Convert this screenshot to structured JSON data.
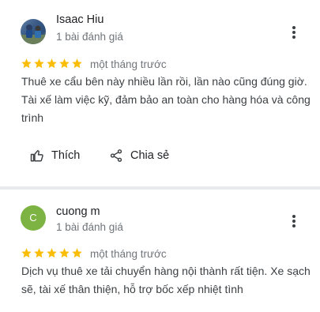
{
  "reviews": [
    {
      "name": "Isaac Hiu",
      "review_count": "1 bài đánh giá",
      "rating": 5,
      "date": "một tháng trước",
      "text": "Thuê xe cẩu bên này nhiều lần rồi, lần nào cũng đúng giờ. Tài xế làm việc kỹ, đảm bảo an toàn cho hàng hóa và công trình",
      "like_label": "Thích",
      "share_label": "Chia sẻ"
    },
    {
      "name": "cuong m",
      "avatar_letter": "C",
      "review_count": "1 bài đánh giá",
      "rating": 5,
      "date": "một tháng trước",
      "text": "Dịch vụ thuê xe tải chuyển hàng nội thành rất tiện. Xe sạch sẽ, tài xế thân thiện, hỗ trợ bốc xếp nhiệt tình"
    }
  ],
  "colors": {
    "star": "#fbbc04",
    "avatar_letter_bg": "#7cb342"
  },
  "icons": {
    "more": "more-vert-icon",
    "like": "thumb-up-icon",
    "share": "share-icon",
    "star": "star-icon"
  }
}
